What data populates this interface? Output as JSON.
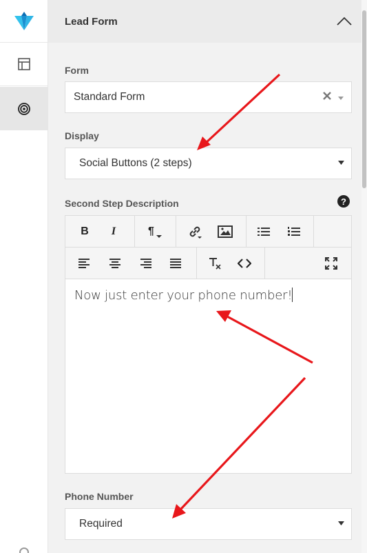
{
  "sidebar": {
    "logo_icon": "brand-logo",
    "items": [
      {
        "icon": "layout-icon",
        "active": false
      },
      {
        "icon": "target-icon",
        "active": true
      }
    ]
  },
  "panel": {
    "title": "Lead Form",
    "collapse_icon": "chevron-up-icon"
  },
  "form_field": {
    "label": "Form",
    "value": "Standard Form"
  },
  "display_field": {
    "label": "Display",
    "value": "Social Buttons (2 steps)"
  },
  "second_step": {
    "label": "Second Step Description",
    "help": "?",
    "content": "Now just enter your phone number!"
  },
  "editor_toolbar": {
    "row1": [
      {
        "icon": "bold-icon",
        "label": "B"
      },
      {
        "icon": "italic-icon",
        "label": "I"
      },
      {
        "icon": "paragraph-icon",
        "label": "¶"
      },
      {
        "icon": "link-icon"
      },
      {
        "icon": "image-icon"
      },
      {
        "icon": "bulleted-list-icon"
      },
      {
        "icon": "numbered-list-icon"
      }
    ],
    "row2": [
      {
        "icon": "align-left-icon"
      },
      {
        "icon": "align-center-icon"
      },
      {
        "icon": "align-right-icon"
      },
      {
        "icon": "align-justify-icon"
      },
      {
        "icon": "clear-format-icon"
      },
      {
        "icon": "code-view-icon"
      },
      {
        "icon": "fullscreen-icon"
      }
    ]
  },
  "phone_field": {
    "label": "Phone Number",
    "value": "Required"
  },
  "colors": {
    "annotation_arrow": "#e8171b",
    "panel_bg": "#f2f2f2",
    "brand": "#1aa0d8"
  }
}
